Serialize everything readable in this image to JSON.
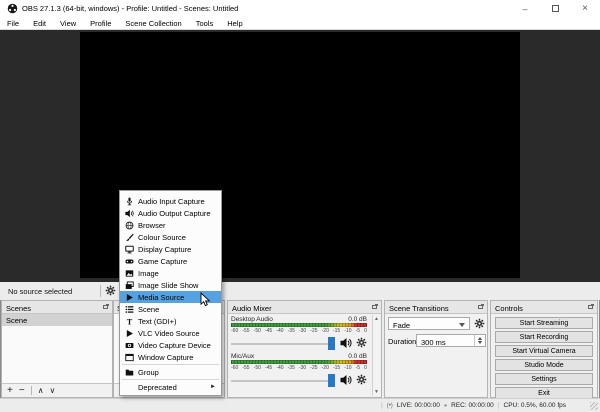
{
  "window": {
    "title": "OBS 27.1.3 (64-bit, windows) - Profile: Untitled - Scenes: Untitled"
  },
  "menubar": {
    "items": [
      "File",
      "Edit",
      "View",
      "Profile",
      "Scene Collection",
      "Tools",
      "Help"
    ]
  },
  "context_menu": {
    "items": [
      {
        "label": "Audio Input Capture",
        "icon": "microphone-icon"
      },
      {
        "label": "Audio Output Capture",
        "icon": "speaker-icon"
      },
      {
        "label": "Browser",
        "icon": "globe-icon"
      },
      {
        "label": "Colour Source",
        "icon": "paintbrush-icon"
      },
      {
        "label": "Display Capture",
        "icon": "display-icon"
      },
      {
        "label": "Game Capture",
        "icon": "gamepad-icon"
      },
      {
        "label": "Image",
        "icon": "image-icon"
      },
      {
        "label": "Image Slide Show",
        "icon": "slideshow-icon"
      },
      {
        "label": "Media Source",
        "icon": "play-icon",
        "highlighted": true
      },
      {
        "label": "Scene",
        "icon": "scene-list-icon"
      },
      {
        "label": "Text (GDI+)",
        "icon": "text-icon"
      },
      {
        "label": "VLC Video Source",
        "icon": "play-icon"
      },
      {
        "label": "Video Capture Device",
        "icon": "camera-icon"
      },
      {
        "label": "Window Capture",
        "icon": "window-icon"
      },
      {
        "label": "Group",
        "icon": "folder-icon"
      },
      {
        "label": "Deprecated",
        "has_submenu": true
      }
    ]
  },
  "contextbar": {
    "message": "No source selected"
  },
  "panels": {
    "scenes": {
      "title": "Scenes",
      "items": [
        "Scene"
      ]
    },
    "sources": {
      "title": "Sources"
    },
    "audio_mixer": {
      "title": "Audio Mixer",
      "channels": [
        {
          "name": "Desktop Audio",
          "gain": "0.0 dB"
        },
        {
          "name": "Mic/Aux",
          "gain": "0.0 dB"
        }
      ],
      "scale_ticks": [
        "-60",
        "-55",
        "-50",
        "-45",
        "-40",
        "-35",
        "-30",
        "-25",
        "-20",
        "-15",
        "-10",
        "-5",
        "0"
      ]
    },
    "scene_transitions": {
      "title": "Scene Transitions",
      "transition": "Fade",
      "duration_label": "Duration",
      "duration_value": "300 ms"
    },
    "controls": {
      "title": "Controls",
      "buttons": [
        "Start Streaming",
        "Start Recording",
        "Start Virtual Camera",
        "Studio Mode",
        "Settings",
        "Exit"
      ]
    }
  },
  "statusbar": {
    "live": "LIVE: 00:00:00",
    "rec": "REC: 00:00:00",
    "cpu": "CPU: 0.5%, 60.00 fps"
  },
  "icons": {
    "plus": "+",
    "minus": "−",
    "up": "∧",
    "down": "∨",
    "scroll_up": "▲",
    "scroll_down": "▼",
    "submenu": "►",
    "minimize": "–",
    "close": "×",
    "live": "(•)",
    "rec_dot": "●",
    "separator": "|"
  },
  "colors": {
    "menu_highlight": "#55a2e2",
    "meter_green": "#3f9c3f",
    "meter_yellow": "#c9c21f",
    "meter_red": "#cc2e2e",
    "slider_handle": "#2878c8",
    "workspace": "#2a2a2a"
  }
}
